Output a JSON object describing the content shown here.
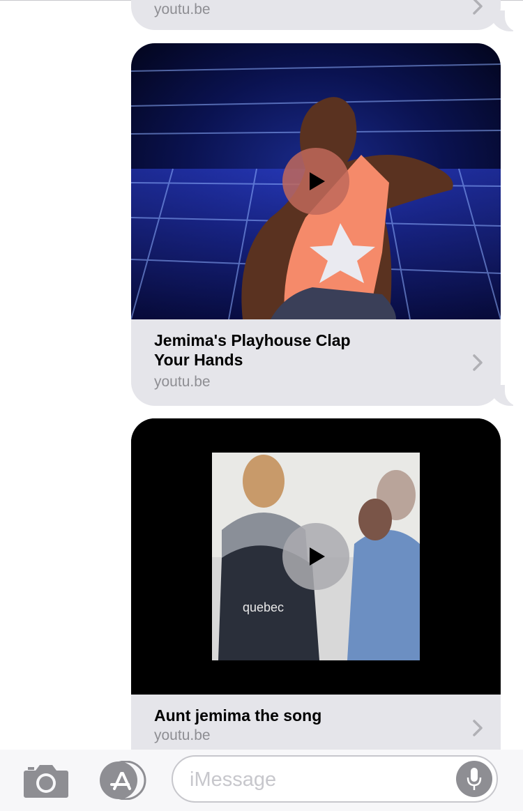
{
  "messages": [
    {
      "title": "",
      "domain": "youtu.be"
    },
    {
      "title": "Jemima's Playhouse Clap Your Hands",
      "domain": "youtu.be"
    },
    {
      "title": "Aunt jemima the song",
      "domain": "youtu.be"
    }
  ],
  "composer": {
    "placeholder": "iMessage"
  },
  "icons": [
    "camera-icon",
    "app-store-icon",
    "microphone-icon",
    "play-icon",
    "chevron-right-icon"
  ],
  "colors": {
    "bubble": "#e5e5ea",
    "secondary_text": "#8e8e93",
    "play_button_tint": "#c0685a"
  }
}
